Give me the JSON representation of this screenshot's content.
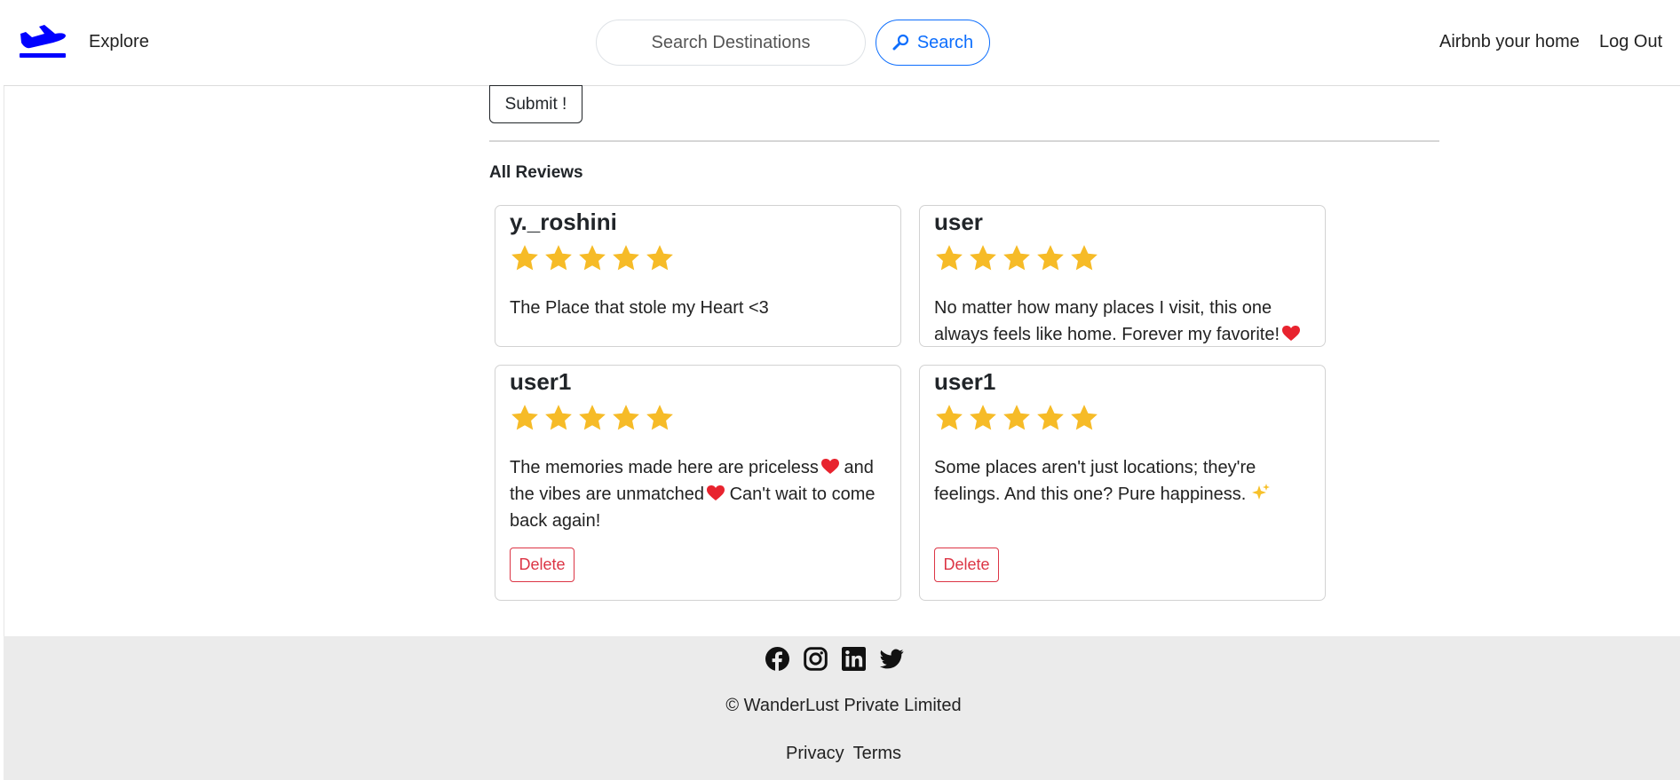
{
  "nav": {
    "explore": "Explore",
    "search_placeholder": "Search Destinations",
    "search_label": "Search",
    "host_link": "Airbnb your home",
    "logout": "Log Out",
    "brand_color": "#0000ff",
    "accent": "#0d6efd"
  },
  "form": {
    "submit_label": "Submit !"
  },
  "reviews": {
    "title": "All Reviews",
    "star_color": "#f6bb27",
    "items": [
      {
        "user": "y._roshini",
        "rating": 5,
        "text": "The Place that stole my Heart <3",
        "has_delete": false
      },
      {
        "user": "user",
        "rating": 5,
        "text": "No matter how many places I visit, this one always feels like home. Forever my favorite!",
        "has_delete": false
      },
      {
        "user": "user1",
        "rating": 5,
        "text_a": "The memories made here are priceless",
        "text_b": " and the vibes are unmatched",
        "text_c": " Can't wait to come back again!",
        "delete_label": "Delete",
        "has_delete": true
      },
      {
        "user": "user1",
        "rating": 5,
        "text": "Some places aren't just locations; they're feelings. And this one? Pure happiness.",
        "delete_label": "Delete",
        "has_delete": true
      }
    ]
  },
  "footer": {
    "social_icons": [
      "facebook-icon",
      "instagram-icon",
      "linkedin-icon",
      "twitter-icon"
    ],
    "copyright": "© WanderLust Private Limited",
    "privacy": "Privacy",
    "terms": "Terms",
    "background": "#ebebeb"
  }
}
